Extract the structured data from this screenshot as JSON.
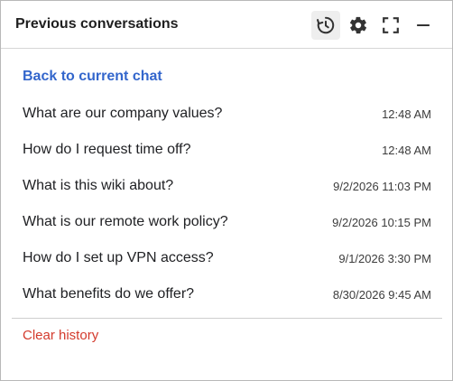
{
  "header": {
    "title": "Previous conversations",
    "icons": [
      "history-icon",
      "gear-icon",
      "fullscreen-icon",
      "minimize-icon"
    ]
  },
  "back_label": "Back to current chat",
  "conversations": [
    {
      "question": "What are our company values?",
      "time": "12:48 AM"
    },
    {
      "question": "How do I request time off?",
      "time": "12:48 AM"
    },
    {
      "question": "What is this wiki about?",
      "time": "9/2/2026 11:03 PM"
    },
    {
      "question": "What is our remote work policy?",
      "time": "9/2/2026 10:15 PM"
    },
    {
      "question": "How do I set up VPN access?",
      "time": "9/1/2026 3:30 PM"
    },
    {
      "question": "What benefits do we offer?",
      "time": "8/30/2026 9:45 AM"
    }
  ],
  "clear_label": "Clear history",
  "colors": {
    "link": "#3366cc",
    "danger": "#d33a2c",
    "text": "#202124",
    "border": "#b8b8b8"
  }
}
